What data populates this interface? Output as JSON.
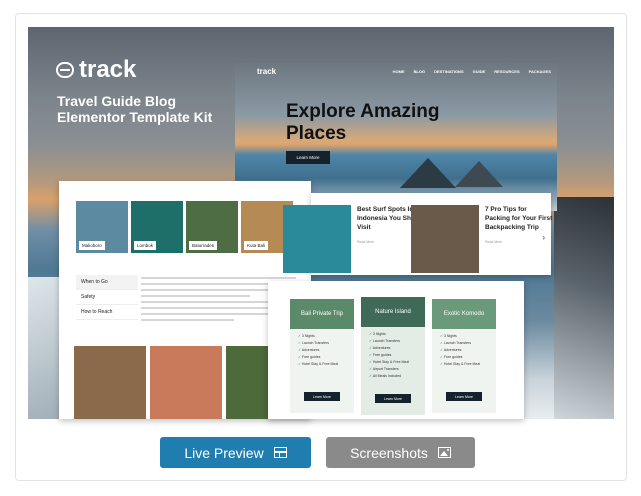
{
  "template": {
    "brand": "track",
    "tagline": "Travel Guide Blog Elementor Template Kit"
  },
  "site_preview": {
    "logo": "track",
    "nav": [
      "HOME",
      "BLOG",
      "DESTINATIONS",
      "GUIDE",
      "RESOURCES",
      "PACKAGES"
    ],
    "hero_title": "Explore Amazing Places",
    "hero_button": "Learn More"
  },
  "destinations": [
    {
      "name": "Malioboro",
      "color": "#5c8aa0"
    },
    {
      "name": "Lombok",
      "color": "#1e6f6a"
    },
    {
      "name": "Baturraden",
      "color": "#4f6d44"
    },
    {
      "name": "Kuta Bali",
      "color": "#b58a55"
    }
  ],
  "guide_menu": [
    "When to Go",
    "Safety",
    "How to Reach"
  ],
  "photo_colors": [
    "#8a6a4a",
    "#c97a5a",
    "#4d6a3a"
  ],
  "posts": [
    {
      "title": "Best Surf Spots In Indonesia You Should Visit",
      "more": "Read More",
      "color": "#2b8a9a"
    },
    {
      "title": "7 Pro Tips for Packing for Your First Backpacking Trip",
      "more": "Read More",
      "color": "#6a5a4a"
    }
  ],
  "packages": [
    {
      "name": "Bali Private Trip",
      "color": "#5a8a6a",
      "features": [
        "3 Nights",
        "Launch Transfers",
        "Adventures",
        "Free guides",
        "Hotel Stay & Free Meal"
      ],
      "button": "Learn More"
    },
    {
      "name": "Nature Island",
      "color": "#3f6a58",
      "features": [
        "3 Nights",
        "Launch Transfers",
        "Adventures",
        "Free guides",
        "Hotel Stay & Free Meal",
        "Airport Transfers",
        "All Meals Included"
      ],
      "button": "Learn More"
    },
    {
      "name": "Exotic Komodo",
      "color": "#6a9a7a",
      "features": [
        "3 Nights",
        "Launch Transfers",
        "Adventures",
        "Free guides",
        "Hotel Stay & Free Meal"
      ],
      "button": "Learn More"
    }
  ],
  "actions": {
    "live_preview": "Live Preview",
    "screenshots": "Screenshots"
  },
  "colors": {
    "live_preview": "#1f7db0",
    "screenshots": "#8a8a8a",
    "dark": "#15222c"
  },
  "icons": {
    "live_preview": "layout-grid-icon",
    "screenshots": "image-icon"
  }
}
